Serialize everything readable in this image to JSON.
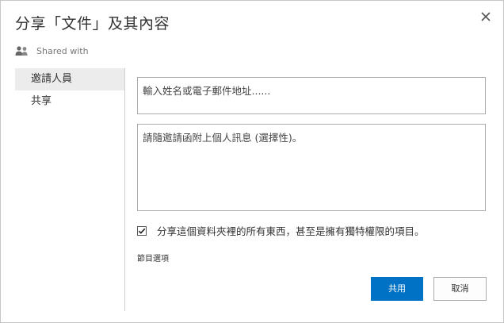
{
  "dialog": {
    "title": "分享「文件」及其內容",
    "shared_with_label": "Shared with",
    "icons": {
      "close": "close-icon",
      "people": "people-icon",
      "check": "checkmark-icon"
    }
  },
  "sidebar": {
    "items": [
      {
        "label": "邀請人員",
        "selected": true
      },
      {
        "label": "共享",
        "selected": false
      }
    ]
  },
  "form": {
    "invite_placeholder": "輸入姓名或電子郵件地址......",
    "message_placeholder": "請隨邀請函附上個人訊息 (選擇性)。",
    "share_everything_label": "分享這個資料夾裡的所有東西，甚至是擁有獨特權限的項目。",
    "share_everything_checked": true,
    "options_link": "節目選項"
  },
  "buttons": {
    "share_label": "共用",
    "cancel_label": "取消"
  },
  "colors": {
    "accent": "#0072c6",
    "selected_bg": "#ececec",
    "border": "#ababab"
  }
}
